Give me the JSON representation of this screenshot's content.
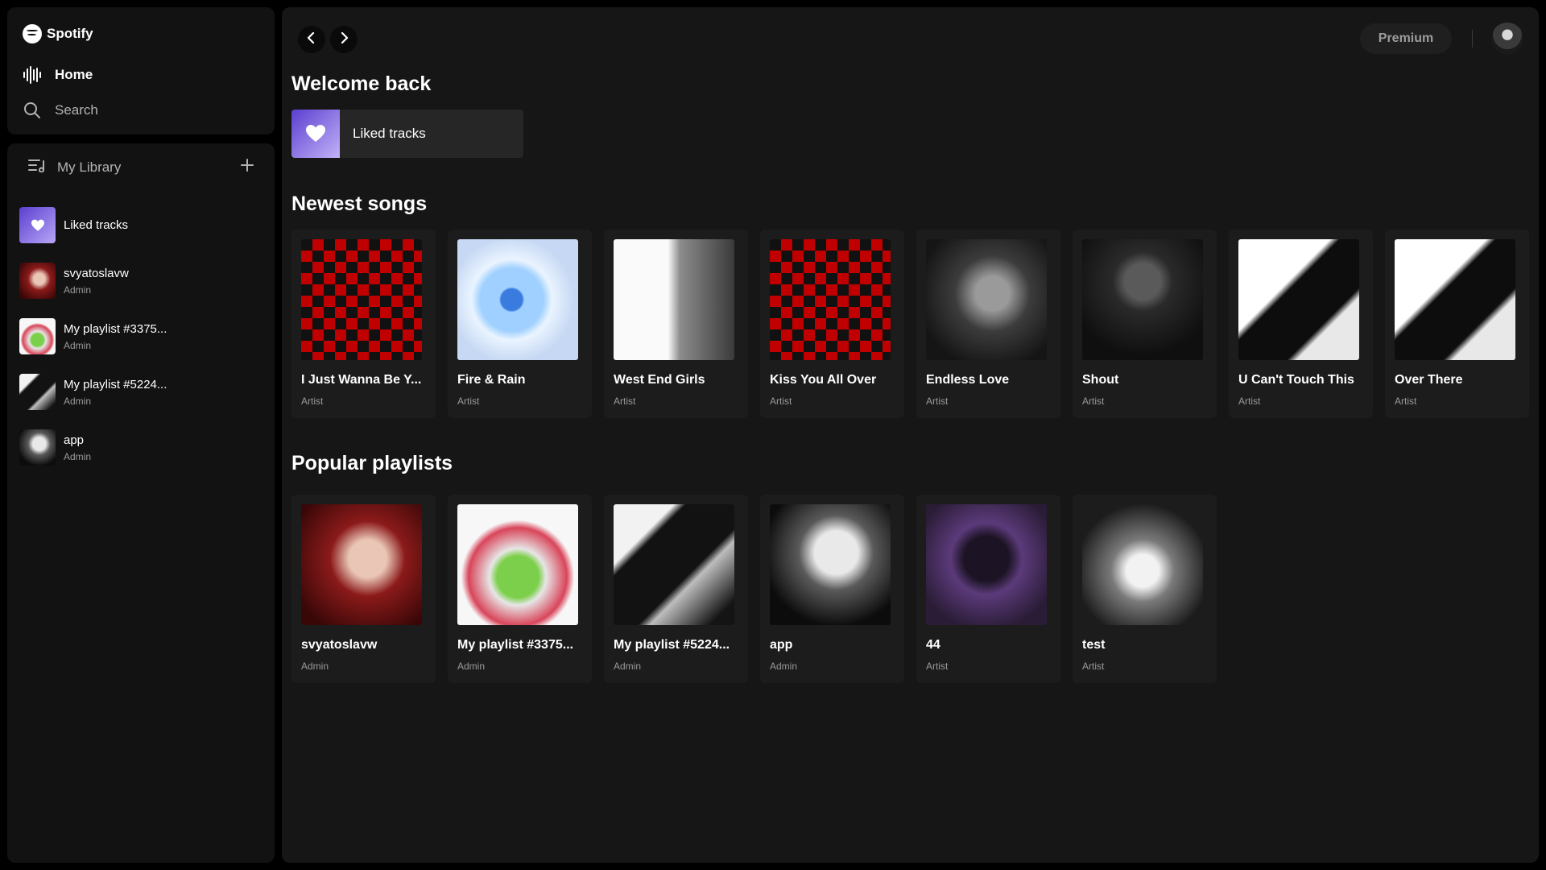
{
  "brand": {
    "name": "Spotify"
  },
  "nav": {
    "home": "Home",
    "search": "Search"
  },
  "library": {
    "title": "My Library",
    "items": [
      {
        "title": "Liked tracks",
        "sub": "",
        "art": "liked"
      },
      {
        "title": "svyatoslavw",
        "sub": "Admin",
        "art": "a1"
      },
      {
        "title": "My playlist #3375...",
        "sub": "Admin",
        "art": "a2"
      },
      {
        "title": "My playlist #5224...",
        "sub": "Admin",
        "art": "a3"
      },
      {
        "title": "app",
        "sub": "Admin",
        "art": "a4"
      }
    ]
  },
  "topbar": {
    "premium": "Premium"
  },
  "main": {
    "welcome": "Welcome back",
    "liked_tile": "Liked tracks",
    "newest_title": "Newest songs",
    "newest": [
      {
        "title": "I Just Wanna Be Y...",
        "sub": "Artist",
        "art": "red"
      },
      {
        "title": "Fire & Rain",
        "sub": "Artist",
        "art": "blue"
      },
      {
        "title": "West End Girls",
        "sub": "Artist",
        "art": "white"
      },
      {
        "title": "Kiss You All Over",
        "sub": "Artist",
        "art": "red"
      },
      {
        "title": "Endless Love",
        "sub": "Artist",
        "art": "gray"
      },
      {
        "title": "Shout",
        "sub": "Artist",
        "art": "dark"
      },
      {
        "title": "U Can't Touch This",
        "sub": "Artist",
        "art": "bw"
      },
      {
        "title": "Over There",
        "sub": "Artist",
        "art": "bw"
      }
    ],
    "popular_title": "Popular playlists",
    "popular": [
      {
        "title": "svyatoslavw",
        "sub": "Admin",
        "art": "a1"
      },
      {
        "title": "My playlist #3375...",
        "sub": "Admin",
        "art": "a2"
      },
      {
        "title": "My playlist #5224...",
        "sub": "Admin",
        "art": "a3"
      },
      {
        "title": "app",
        "sub": "Admin",
        "art": "a4"
      },
      {
        "title": "44",
        "sub": "Artist",
        "art": "purple"
      },
      {
        "title": "test",
        "sub": "Artist",
        "art": "hood"
      }
    ]
  }
}
